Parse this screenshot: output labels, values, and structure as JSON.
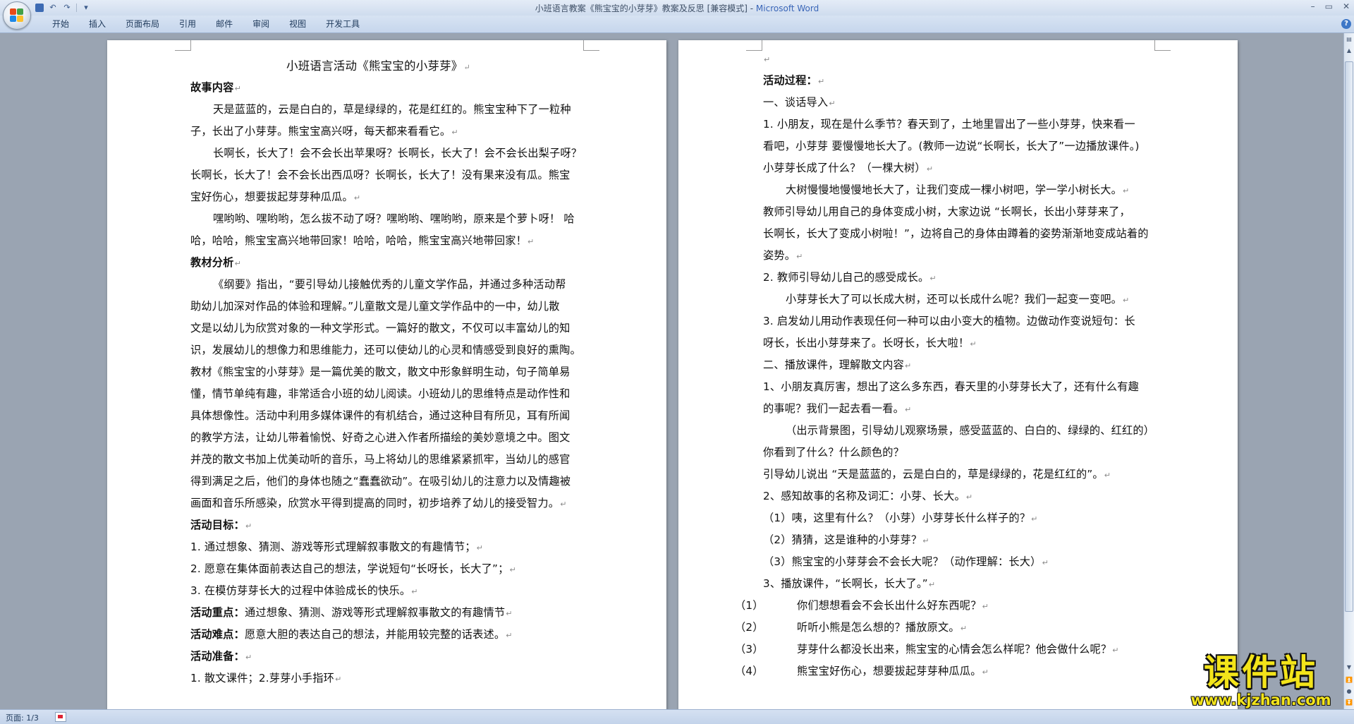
{
  "window": {
    "title": "小班语言教案《熊宝宝的小芽芽》教案及反思 [兼容模式] - ",
    "app_name": "Microsoft Word",
    "controls": [
      "–",
      "▭",
      "✕"
    ]
  },
  "ribbon": {
    "tabs": [
      "开始",
      "插入",
      "页面布局",
      "引用",
      "邮件",
      "审阅",
      "视图",
      "开发工具"
    ],
    "help": "?"
  },
  "paragraph_mark": "↵",
  "page1": {
    "title": "小班语言活动《熊宝宝的小芽芽》",
    "lines": [
      "故事内容",
      "天是蓝蓝的，云是白白的，草是绿绿的，花是红红的。熊宝宝种下了一粒种",
      "子，长出了小芽芽。熊宝宝高兴呀，每天都来看看它。",
      "长啊长，长大了！会不会长出苹果呀？长啊长，长大了！会不会长出梨子呀？",
      "长啊长，长大了！会不会长出西瓜呀？长啊长，长大了！没有果来没有瓜。熊宝",
      "宝好伤心，想要拔起芽芽种瓜瓜。",
      "嘿哟哟、嘿哟哟，怎么拔不动了呀？嘿哟哟、嘿哟哟，原来是个萝卜呀！ 哈",
      "哈，哈哈，熊宝宝高兴地带回家！哈哈，哈哈，熊宝宝高兴地带回家！",
      "教材分析",
      "《纲要》指出，“要引导幼儿接触优秀的儿童文学作品，并通过多种活动帮",
      "助幼儿加深对作品的体验和理解。”儿童散文是儿童文学作品中的一中，幼儿散",
      "文是以幼儿为欣赏对象的一种文学形式。一篇好的散文，不仅可以丰富幼儿的知",
      "识，发展幼儿的想像力和思维能力，还可以使幼儿的心灵和情感受到良好的熏陶。",
      "教材《熊宝宝的小芽芽》是一篇优美的散文，散文中形象鲜明生动，句子简单易",
      "懂，情节单纯有趣，非常适合小班的幼儿阅读。小班幼儿的思维特点是动作性和",
      "具体想像性。活动中利用多媒体课件的有机结合，通过这种目有所见，耳有所闻",
      "的教学方法，让幼儿带着愉悦、好奇之心进入作者所描绘的美妙意境之中。图文",
      "并茂的散文书加上优美动听的音乐，马上将幼儿的思维紧紧抓牢，当幼儿的感官",
      "得到满足之后，他们的身体也随之“蠢蠢欲动”。在吸引幼儿的注意力以及情趣被",
      "画面和音乐所感染，欣赏水平得到提高的同时，初步培养了幼儿的接受智力。",
      "活动目标：",
      "1. 通过想象、猜测、游戏等形式理解叙事散文的有趣情节；",
      "2. 愿意在集体面前表达自己的想法，学说短句“长呀长，长大了”；",
      "3. 在模仿芽芽长大的过程中体验成长的快乐。",
      "活动重点：",
      "通过想象、猜测、游戏等形式理解叙事散文的有趣情节",
      "活动难点：",
      "愿意大胆的表达自己的想法，并能用较完整的话表述。",
      "活动准备：",
      "1. 散文课件；2.芽芽小手指环"
    ]
  },
  "page2": {
    "lines": [
      "活动过程：",
      "一、谈话导入",
      "1. 小朋友，现在是什么季节？春天到了，土地里冒出了一些小芽芽，快来看一",
      "看吧，小芽芽 要慢慢地长大了。(教师一边说“长啊长，长大了”一边播放课件。)",
      "小芽芽长成了什么？（一棵大树）",
      "大树慢慢地慢慢地长大了，让我们变成一棵小树吧，学一学小树长大。",
      "教师引导幼儿用自己的身体变成小树，大家边说 “长啊长，长出小芽芽来了，",
      "长啊长，长大了变成小树啦！”，边将自己的身体由蹲着的姿势渐渐地变成站着的",
      "姿势。",
      "2. 教师引导幼儿自己的感受成长。",
      "小芽芽长大了可以长成大树，还可以长成什么呢？我们一起变一变吧。",
      "3. 启发幼儿用动作表现任何一种可以由小变大的植物。边做动作变说短句：长",
      "呀长，长出小芽芽来了。长呀长，长大啦！",
      "二、播放课件，理解散文内容",
      "1、小朋友真厉害，想出了这么多东西，春天里的小芽芽长大了，还有什么有趣",
      "的事呢？我们一起去看一看。",
      "（出示背景图，引导幼儿观察场景，感受蓝蓝的、白白的、绿绿的、红红的）",
      "你看到了什么？什么颜色的？",
      "引导幼儿说出 “天是蓝蓝的，云是白白的，草是绿绿的，花是红红的”。",
      "2、感知故事的名称及词汇：小芽、长大。",
      "（1）咦，这里有什么？（小芽）小芽芽长什么样子的？",
      "（2）猜猜，这是谁种的小芽芽？",
      "（3）熊宝宝的小芽芽会不会长大呢？（动作理解：长大）",
      "3、播放课件，“长啊长，长大了。”",
      "（1）",
      "你们想想看会不会长出什么好东西呢？",
      "（2）",
      "听听小熊是怎么想的？播放原文。",
      "（3）",
      "芽芽什么都没长出来，熊宝宝的心情会怎么样呢？他会做什么呢？",
      "（4）",
      "熊宝宝好伤心，想要拔起芽芽种瓜瓜。"
    ]
  },
  "status": {
    "pages": "页面: 1/3"
  },
  "watermark": {
    "title": "课件站",
    "url": "www.kjzhan.com"
  }
}
